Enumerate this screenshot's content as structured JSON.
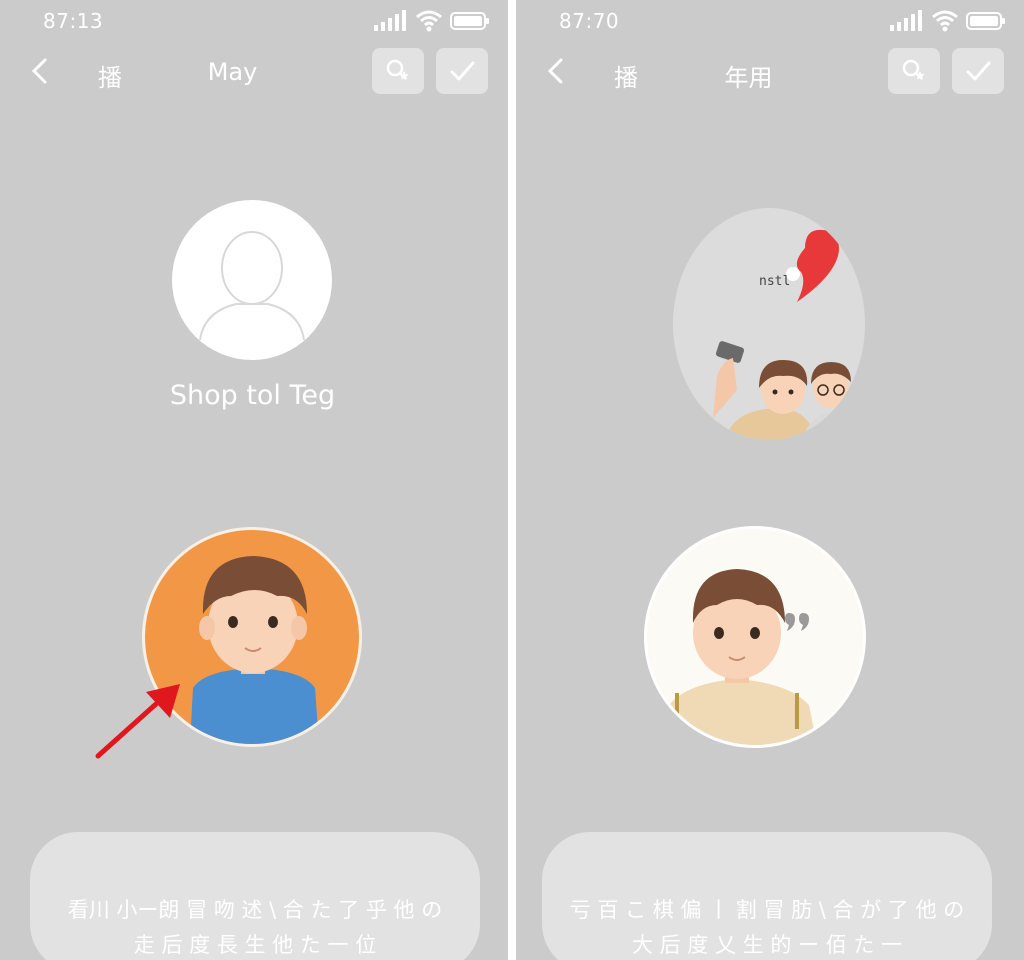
{
  "screens": [
    {
      "status_bar": {
        "time": "87:13"
      },
      "nav": {
        "left_label": "播",
        "title": "May"
      },
      "profile": {
        "label": "Shop tol Teg"
      },
      "bottom_card": {
        "line1": "看川 小ー朗 冒 吻 述 \\ 合 た 了 乎 他 の",
        "line2": "走 后 度 長 生 他 た 一 位"
      }
    },
    {
      "status_bar": {
        "time": "87:70"
      },
      "nav": {
        "left_label": "播",
        "title": "年用"
      },
      "photo": {
        "bubble_text": "nstl"
      },
      "bottom_card": {
        "line1": "亏 百 こ 棋 偏 丨 割 冒 肪 \\ 合 が 了 他 の",
        "line2": "大 后 度 乂 生 的 ー 佰 た 一"
      }
    }
  ],
  "colors": {
    "screen_bg": "#cbcbcb",
    "orange_avatar": "#f29745",
    "shirt_blue": "#4b8fd1",
    "hair_brown": "#7a4e36",
    "arrow_red": "#e0181d",
    "heart_red": "#e8393a"
  },
  "icons": [
    "back-icon",
    "search-star-icon",
    "check-icon",
    "signal-icon",
    "wifi-icon",
    "battery-icon",
    "arrow-icon"
  ]
}
